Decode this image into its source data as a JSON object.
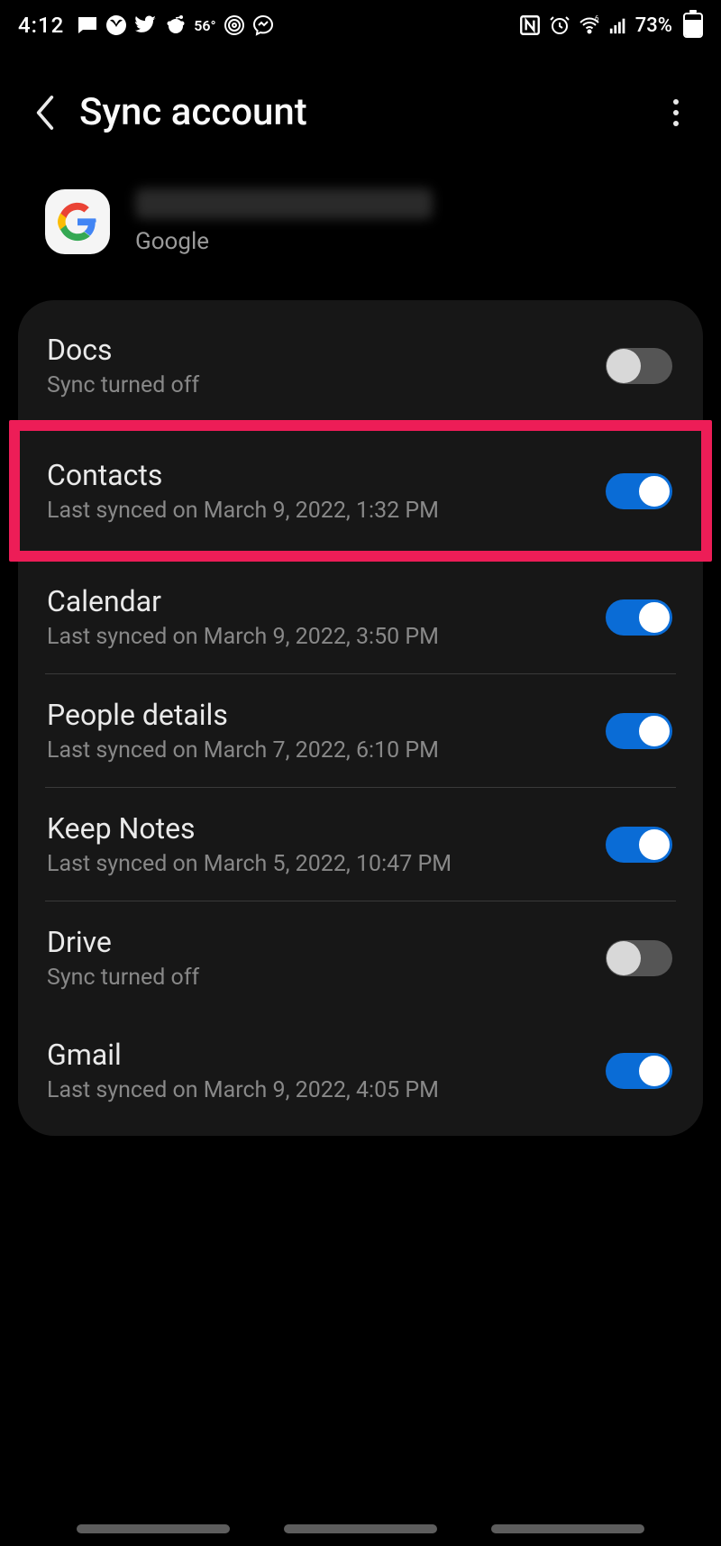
{
  "status": {
    "time": "4:12",
    "temp": "56°",
    "battery_pct": "73%"
  },
  "header": {
    "title": "Sync account"
  },
  "account": {
    "type_label": "Google"
  },
  "sync": [
    {
      "title": "Docs",
      "subtitle": "Sync turned off",
      "on": false,
      "highlighted": false
    },
    {
      "title": "Contacts",
      "subtitle": "Last synced on March 9, 2022, 1:32 PM",
      "on": true,
      "highlighted": true
    },
    {
      "title": "Calendar",
      "subtitle": "Last synced on March 9, 2022, 3:50 PM",
      "on": true,
      "highlighted": false
    },
    {
      "title": "People details",
      "subtitle": "Last synced on March 7, 2022, 6:10 PM",
      "on": true,
      "highlighted": false
    },
    {
      "title": "Keep Notes",
      "subtitle": "Last synced on March 5, 2022, 10:47 PM",
      "on": true,
      "highlighted": false
    },
    {
      "title": "Drive",
      "subtitle": "Sync turned off",
      "on": false,
      "highlighted": false
    },
    {
      "title": "Gmail",
      "subtitle": "Last synced on March 9, 2022, 4:05 PM",
      "on": true,
      "highlighted": false
    }
  ]
}
